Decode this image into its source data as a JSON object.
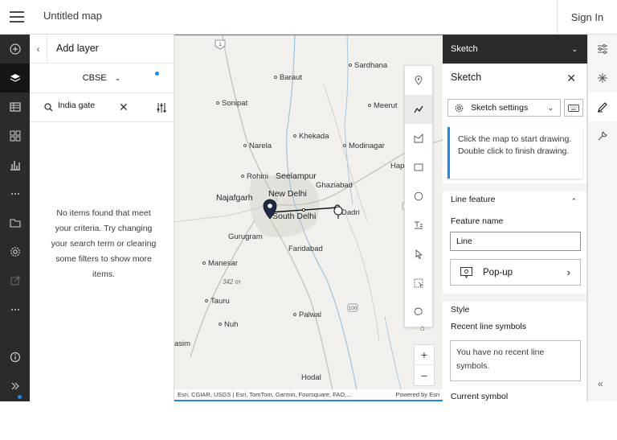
{
  "header": {
    "title": "Untitled map",
    "sign_in": "Sign In"
  },
  "left_toolbar": {
    "items": [
      {
        "name": "add-icon"
      },
      {
        "name": "layers-icon"
      },
      {
        "name": "table-icon"
      },
      {
        "name": "widgets-icon"
      },
      {
        "name": "charts-icon"
      },
      {
        "name": "more-icon"
      },
      {
        "name": "folder-icon"
      },
      {
        "name": "settings-icon"
      },
      {
        "name": "share-icon"
      },
      {
        "name": "more-icon"
      },
      {
        "name": "info-icon"
      },
      {
        "name": "expand-icon"
      }
    ]
  },
  "add_layer": {
    "title": "Add layer",
    "source": "CBSE",
    "search_value": "India gate",
    "empty_message": "No items found that meet your criteria. Try changing your search term or clearing some filters to show more items."
  },
  "map": {
    "places": [
      {
        "label": "Sonipat"
      },
      {
        "label": "Baraut"
      },
      {
        "label": "Sardhana"
      },
      {
        "label": "Meerut"
      },
      {
        "label": "Narela"
      },
      {
        "label": "Khekada"
      },
      {
        "label": "Modinagar"
      },
      {
        "label": "Rohini"
      },
      {
        "label": "Seelampur"
      },
      {
        "label": "Ghaziabad"
      },
      {
        "label": "Hap"
      },
      {
        "label": "Najafgarh"
      },
      {
        "label": "New Delhi"
      },
      {
        "label": "South Delhi"
      },
      {
        "label": "Dadri"
      },
      {
        "label": "Gurugram"
      },
      {
        "label": "Faridabad"
      },
      {
        "label": "Manesar"
      },
      {
        "label": "342 m"
      },
      {
        "label": "Tauru"
      },
      {
        "label": "Palwal"
      },
      {
        "label": "Nuh"
      },
      {
        "label": "asim"
      },
      {
        "label": "Hodal"
      }
    ],
    "attribution": "Esri, CGIAR, USGS | Esri, TomTom, Garmin, Foursquare, FAO,...",
    "powered_by": "Powered by Esri"
  },
  "sketch": {
    "header_label": "Sketch",
    "title": "Sketch",
    "settings_label": "Sketch settings",
    "note": "Click the map to start drawing. Double click to finish drawing.",
    "section_line_feature": "Line feature",
    "feature_name_label": "Feature name",
    "feature_name_value": "Line",
    "popup_label": "Pop-up",
    "section_style": "Style",
    "recent_line_symbols_label": "Recent line symbols",
    "recent_empty": "You have no recent line symbols.",
    "current_symbol_label": "Current symbol"
  }
}
